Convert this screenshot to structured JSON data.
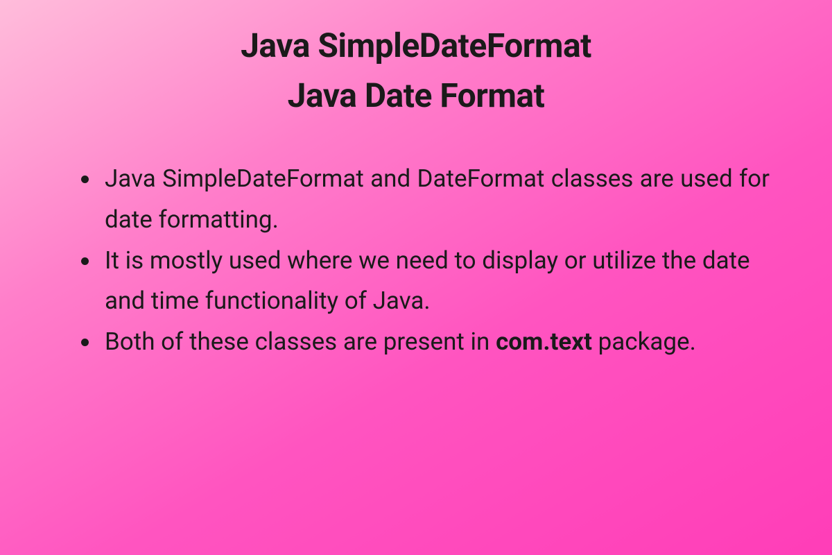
{
  "title": {
    "line1": "Java SimpleDateFormat",
    "line2": "Java Date Format"
  },
  "bullets": [
    {
      "text": "Java SimpleDateFormat and DateFormat classes are used for date formatting.",
      "justify": true
    },
    {
      "text": "It is mostly used where we need to display or utilize the date and time functionality of Java.",
      "justify": false
    },
    {
      "pre": "Both of these classes are present in ",
      "bold": "com.text",
      "post": " package.",
      "justify": false
    }
  ]
}
